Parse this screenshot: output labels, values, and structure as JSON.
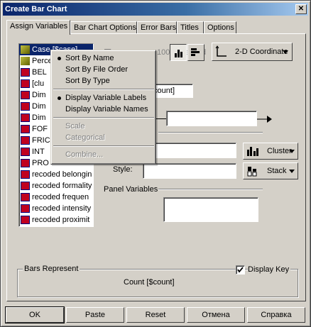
{
  "window": {
    "title": "Create Bar Chart",
    "close_glyph": "✕"
  },
  "tabs": [
    {
      "label": "Assign Variables"
    },
    {
      "label": "Bar Chart Options"
    },
    {
      "label": "Error Bars"
    },
    {
      "label": "Titles"
    },
    {
      "label": "Options"
    }
  ],
  "variables": [
    {
      "label": "Case [$case]",
      "type": "scale"
    },
    {
      "label": "Percent",
      "type": "scale"
    },
    {
      "label": "BEL",
      "type": "nominal"
    },
    {
      "label": "[clu",
      "type": "nominal"
    },
    {
      "label": "Dim",
      "type": "nominal"
    },
    {
      "label": "Dim",
      "type": "nominal"
    },
    {
      "label": "Dim",
      "type": "nominal"
    },
    {
      "label": "FOF",
      "type": "nominal"
    },
    {
      "label": "FRIC",
      "type": "nominal"
    },
    {
      "label": "INT",
      "type": "nominal"
    },
    {
      "label": "PRO",
      "type": "nominal"
    },
    {
      "label": "recoded belongin",
      "type": "nominal"
    },
    {
      "label": "recoded formality",
      "type": "nominal"
    },
    {
      "label": "recoded frequen",
      "type": "nominal"
    },
    {
      "label": "recoded intensity",
      "type": "nominal"
    },
    {
      "label": "recoded proximit",
      "type": "nominal"
    }
  ],
  "context_menu": {
    "items": [
      {
        "label": "Sort By Name",
        "checked": true,
        "enabled": true
      },
      {
        "label": "Sort By File Order",
        "checked": false,
        "enabled": true
      },
      {
        "label": "Sort By Type",
        "checked": false,
        "enabled": true
      },
      {
        "label": "Display Variable Labels",
        "checked": true,
        "enabled": true
      },
      {
        "label": "Display Variable Names",
        "checked": false,
        "enabled": true
      },
      {
        "label": "Scale",
        "checked": false,
        "enabled": false
      },
      {
        "label": "Categorical",
        "checked": false,
        "enabled": false
      },
      {
        "label": "Combine...",
        "checked": false,
        "enabled": false
      }
    ]
  },
  "options": {
    "hidden_checkbox_label": "100% stacked",
    "coordinate_dropdown": "2-D Coordinate",
    "y_axis_value": "[count]",
    "cluster_label": "Cluster",
    "stack_label": "Stack",
    "style_label": "Style:",
    "panel_variables_label": "Panel Variables"
  },
  "bars_represent": {
    "legend": "Bars Represent",
    "value": "Count [$count]",
    "display_key_label": "Display Key",
    "display_key_checked": true
  },
  "buttons": {
    "ok": "OK",
    "paste": "Paste",
    "reset": "Reset",
    "cancel": "Отмена",
    "help": "Справка"
  },
  "icons": {
    "scale_variable": "ruler-icon",
    "nominal_variable": "nominal-icon",
    "vertical_bar": "vertical-bar-chart-icon",
    "horizontal_bar": "horizontal-bar-chart-icon",
    "coordinate": "coordinate-axis-icon",
    "cluster": "cluster-bars-icon",
    "stack": "stack-bars-icon",
    "arrow_right": "arrow-right-icon",
    "dropdown": "chevron-down-icon"
  }
}
